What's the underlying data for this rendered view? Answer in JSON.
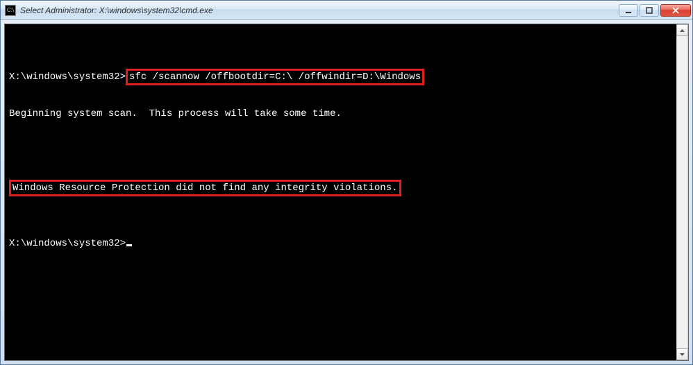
{
  "window": {
    "title": "Select Administrator: X:\\windows\\system32\\cmd.exe"
  },
  "console": {
    "prompt1": "X:\\windows\\system32>",
    "command": "sfc /scannow /offbootdir=C:\\ /offwindir=D:\\Windows",
    "line_scan": "Beginning system scan.  This process will take some time.",
    "line_result": "Windows Resource Protection did not find any integrity violations.",
    "prompt2": "X:\\windows\\system32>"
  }
}
